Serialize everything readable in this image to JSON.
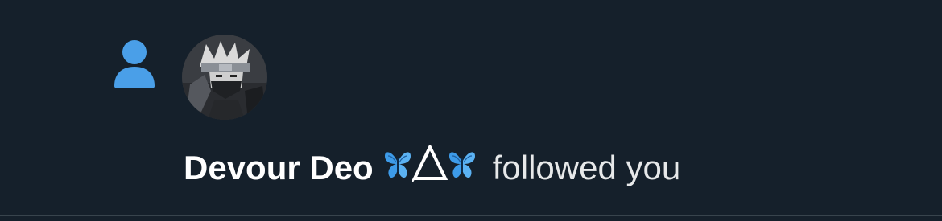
{
  "notification": {
    "type_icon": "person-icon",
    "avatar": "user-avatar-anime",
    "user_name": "Devour Deo",
    "name_emoji": [
      "butterfly-icon",
      "triangle-icon",
      "butterfly-icon"
    ],
    "action_text": "followed you"
  },
  "colors": {
    "background": "#15202b",
    "divider": "#38444d",
    "accent": "#4a9fe8",
    "text": "#ffffff"
  }
}
